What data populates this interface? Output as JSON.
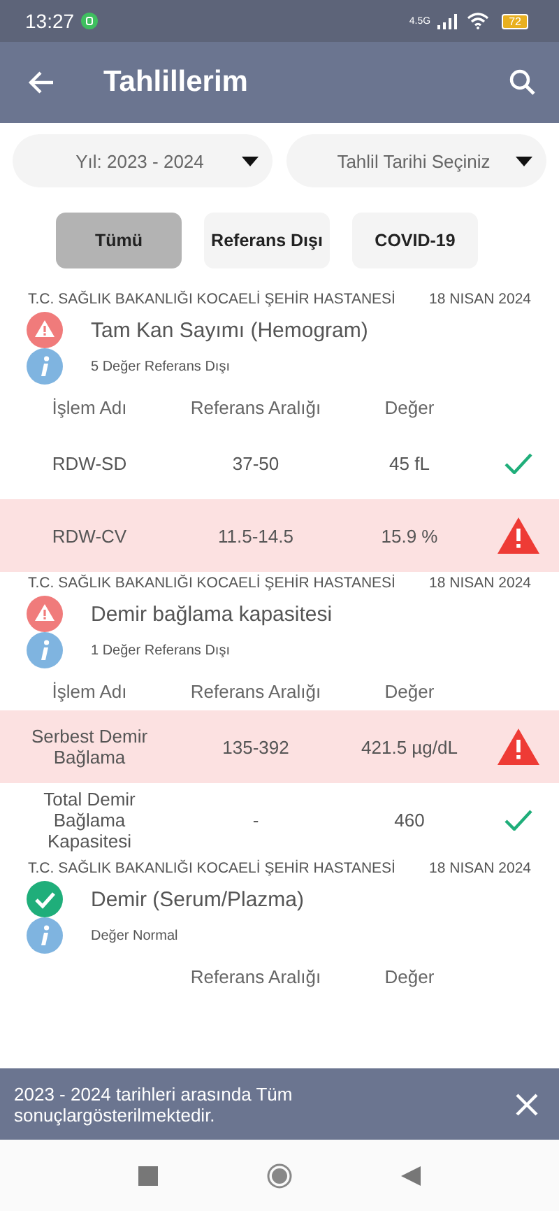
{
  "status_bar": {
    "time": "13:27",
    "network": "4.5G",
    "battery": "72"
  },
  "app_bar": {
    "title": "Tahlillerim"
  },
  "filters": [
    {
      "value": "Yıl: 2023 - 2024"
    },
    {
      "value": "Tahlil Tarihi Seçiniz"
    }
  ],
  "chips": [
    {
      "label": "Tümü",
      "selected": true
    },
    {
      "label": "Referans Dışı",
      "selected": false
    },
    {
      "label": "COVID-19",
      "selected": false
    }
  ],
  "sections": [
    {
      "hospital": "T.C. SAĞLIK BAKANLIĞI KOCAELİ ŞEHİR HASTANESİ",
      "date": "18 NISAN 2024",
      "kind": "warning",
      "title": "Tam Kan Sayımı (Hemogram)",
      "summary": "5 Değer Referans Dışı",
      "columns": {
        "name": "İşlem Adı",
        "range": "Referans Aralığı",
        "value": "Değer"
      },
      "rows": [
        {
          "name": "RDW-SD",
          "range": "37-50",
          "value": "45 fL",
          "out_of_range": false
        },
        {
          "name": "RDW-CV",
          "range": "11.5-14.5",
          "value": "15.9 %",
          "out_of_range": true
        }
      ]
    },
    {
      "hospital": "T.C. SAĞLIK BAKANLIĞI KOCAELİ ŞEHİR HASTANESİ",
      "date": "18 NISAN 2024",
      "kind": "warning",
      "title": "Demir bağlama kapasitesi",
      "summary": "1 Değer Referans Dışı",
      "columns": {
        "name": "İşlem Adı",
        "range": "Referans Aralığı",
        "value": "Değer"
      },
      "rows": [
        {
          "name": "Serbest Demir Bağlama",
          "range": "135-392",
          "value": "421.5 µg/dL",
          "out_of_range": true
        },
        {
          "name": "Total Demir Bağlama Kapasitesi",
          "range": "-",
          "value": "460",
          "out_of_range": false
        }
      ]
    },
    {
      "hospital": "T.C. SAĞLIK BAKANLIĞI KOCAELİ ŞEHİR HASTANESİ",
      "date": "18 NISAN 2024",
      "kind": "normal",
      "title": "Demir (Serum/Plazma)",
      "summary": "Değer Normal",
      "columns": {
        "range": "Referans Aralığı",
        "value": "Değer"
      }
    }
  ],
  "snackbar": {
    "message": "2023 - 2024 tarihleri arasında Tüm sonuçlargösterilmektedir."
  }
}
